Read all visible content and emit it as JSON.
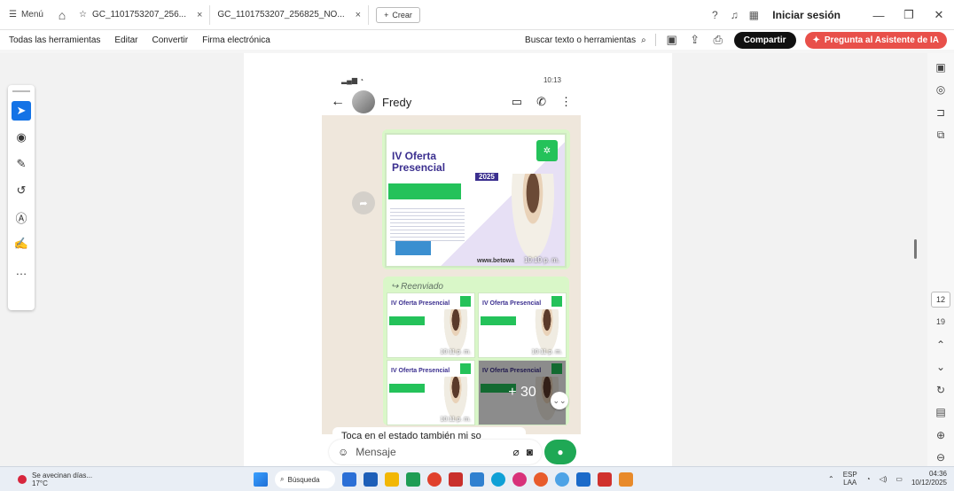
{
  "titlebar": {
    "menu_label": "Menú",
    "tabs": [
      {
        "label": "GC_1101753207_256...",
        "active": true
      },
      {
        "label": "GC_1101753207_256825_NO...",
        "active": false
      }
    ],
    "new_tab_label": "Crear",
    "login_label": "Iniciar sesión"
  },
  "toolbar": {
    "items": [
      "Todas las herramientas",
      "Editar",
      "Convertir",
      "Firma electrónica"
    ],
    "search_label": "Buscar texto o herramientas",
    "share_label": "Compartir",
    "ai_label": "Pregunta al Asistente de IA"
  },
  "right_panel": {
    "page_current": "12",
    "page_total": "19"
  },
  "phone": {
    "status_time": "10:13",
    "contact_name": "Fredy",
    "flyer": {
      "title_line1": "IV Oferta",
      "title_line2": "Presencial",
      "year": "2025",
      "url": "www.betowa",
      "time": "10:10 p. m."
    },
    "forwarded_label": "Reenviado",
    "thumbs": [
      {
        "title": "IV Oferta Presencial",
        "time": "10:11 p. m."
      },
      {
        "title": "IV Oferta Presencial",
        "time": "10:11 p. m."
      },
      {
        "title": "IV Oferta Presencial",
        "time": "10:11 p. m."
      },
      {
        "title": "IV Oferta Presencial",
        "time": ""
      }
    ],
    "more_count": "+ 30",
    "hint_text": "Toca en el estado también mi so",
    "input_placeholder": "Mensaje"
  },
  "taskbar": {
    "weather_line1": "Se avecinan días...",
    "weather_line2": "17°C",
    "search_label": "Búsqueda",
    "lang_line1": "ESP",
    "lang_line2": "LAA",
    "time": "04:36",
    "date": "10/12/2025"
  },
  "colors": {
    "share_bg": "#111111",
    "ai_bg": "#e8504a",
    "accent_blue": "#1473e6",
    "whatsapp_green": "#1fa855"
  }
}
